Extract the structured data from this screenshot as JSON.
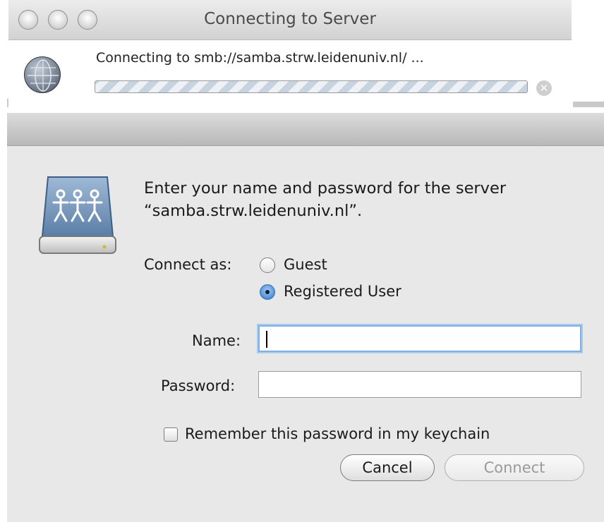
{
  "connecting_window": {
    "title": "Connecting to Server",
    "status_text": "Connecting to smb://samba.strw.leidenuniv.nl/ ...",
    "stop_icon": "close-circle-icon",
    "globe_icon": "network-globe-icon"
  },
  "login": {
    "server_icon": "shared-server-people-icon",
    "prompt_line1": "Enter your name and password for the server",
    "prompt_line2": "“samba.strw.leidenuniv.nl”.",
    "connect_as_label": "Connect as:",
    "options": [
      {
        "label": "Guest",
        "selected": false
      },
      {
        "label": "Registered User",
        "selected": true
      }
    ],
    "name_label": "Name:",
    "name_value": "",
    "password_label": "Password:",
    "password_value": "",
    "remember_label": "Remember this password in my keychain",
    "remember_checked": false,
    "cancel_label": "Cancel",
    "connect_label": "Connect"
  }
}
